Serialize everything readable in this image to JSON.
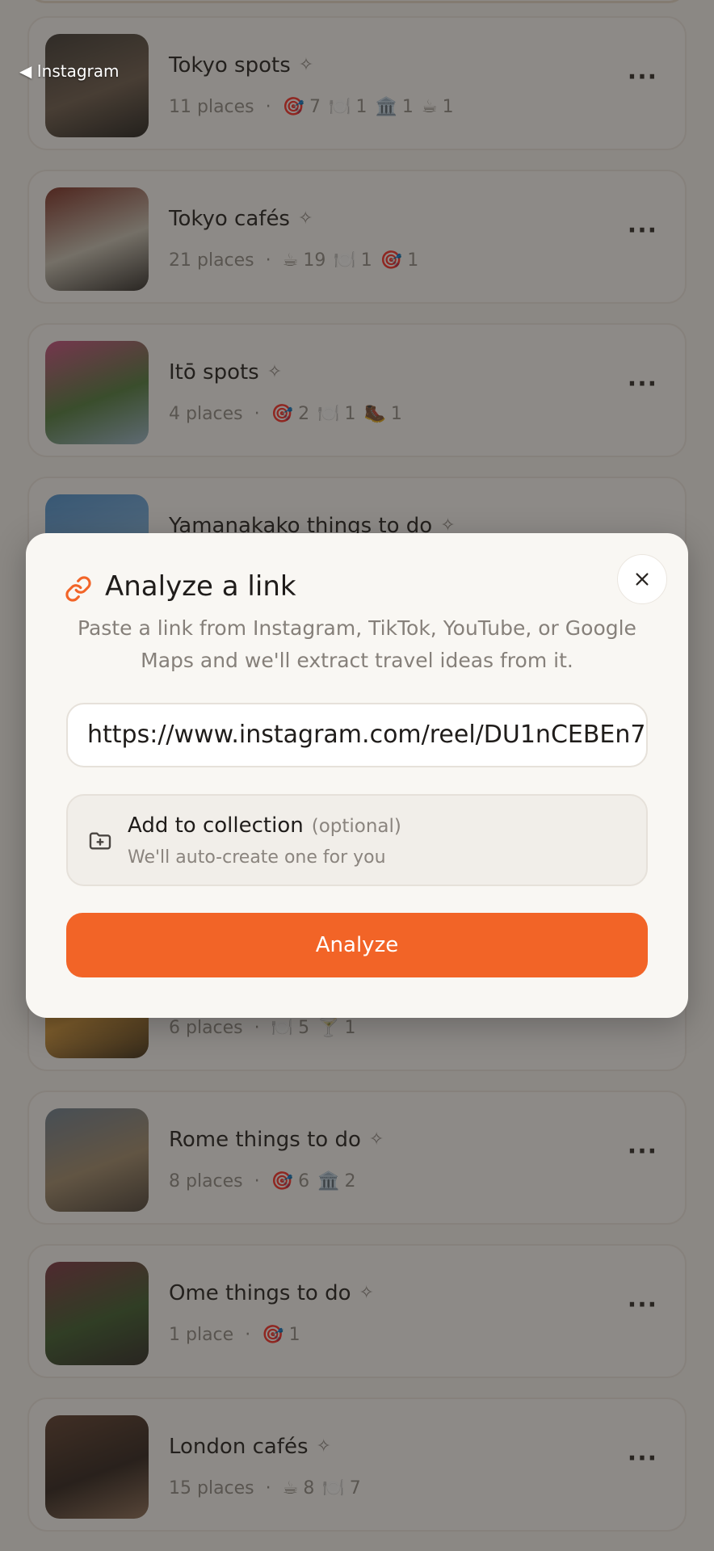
{
  "status_bar": {
    "back_label": "◀ Instagram"
  },
  "collections": [
    {
      "title": "Tokyo spots",
      "count": "11 places",
      "thumb_colors": [
        "#3a3530",
        "#6b5a4a",
        "#1f1d1a"
      ],
      "categories": [
        {
          "icon": "🎯",
          "count": "7"
        },
        {
          "icon": "🍽️",
          "count": "1"
        },
        {
          "icon": "🏛️",
          "count": "1"
        },
        {
          "icon": "☕",
          "count": "1"
        }
      ]
    },
    {
      "title": "Tokyo cafés",
      "count": "21 places",
      "thumb_colors": [
        "#7a2a1f",
        "#c8c2b4",
        "#2c2926"
      ],
      "categories": [
        {
          "icon": "☕",
          "count": "19"
        },
        {
          "icon": "🍽️",
          "count": "1"
        },
        {
          "icon": "🎯",
          "count": "1"
        }
      ]
    },
    {
      "title": "Itō spots",
      "count": "4 places",
      "thumb_colors": [
        "#c74a7e",
        "#4e7a3a",
        "#9ab6cc"
      ],
      "categories": [
        {
          "icon": "🎯",
          "count": "2"
        },
        {
          "icon": "🍽️",
          "count": "1"
        },
        {
          "icon": "🥾",
          "count": "1"
        }
      ]
    },
    {
      "title": "Yamanakako things to do",
      "count": "",
      "thumb_colors": [
        "#4a8fcf",
        "#7ab0de",
        "#2f6fa6"
      ],
      "categories": []
    },
    {
      "title": "",
      "count": "6 places",
      "thumb_colors": [
        "#8a5a1a",
        "#d99a3a",
        "#3a2a12"
      ],
      "categories": [
        {
          "icon": "🍽️",
          "count": "5"
        },
        {
          "icon": "🍸",
          "count": "1"
        }
      ]
    },
    {
      "title": "Rome things to do",
      "count": "8 places",
      "thumb_colors": [
        "#6a7c8e",
        "#a08a6a",
        "#4a4036"
      ],
      "categories": [
        {
          "icon": "🎯",
          "count": "6"
        },
        {
          "icon": "🏛️",
          "count": "2"
        }
      ]
    },
    {
      "title": "Ome things to do",
      "count": "1 place",
      "thumb_colors": [
        "#7a3040",
        "#3a5a2a",
        "#2a2622"
      ],
      "categories": [
        {
          "icon": "🎯",
          "count": "1"
        }
      ]
    },
    {
      "title": "London cafés",
      "count": "15 places",
      "thumb_colors": [
        "#5a3a2a",
        "#2a1e18",
        "#8a6a52"
      ],
      "categories": [
        {
          "icon": "☕",
          "count": "8"
        },
        {
          "icon": "🍽️",
          "count": "7"
        }
      ]
    }
  ],
  "modal": {
    "title": "Analyze a link",
    "description": "Paste a link from Instagram, TikTok, YouTube, or Google Maps and we'll extract travel ideas from it.",
    "url_value": "https://www.instagram.com/reel/DU1nCEBEn7",
    "collection_label": "Add to collection",
    "collection_optional": "(optional)",
    "collection_hint": "We'll auto-create one for you",
    "analyze_label": "Analyze"
  },
  "colors": {
    "accent": "#f26427",
    "overlay": "rgba(40,36,32,0.52)"
  }
}
